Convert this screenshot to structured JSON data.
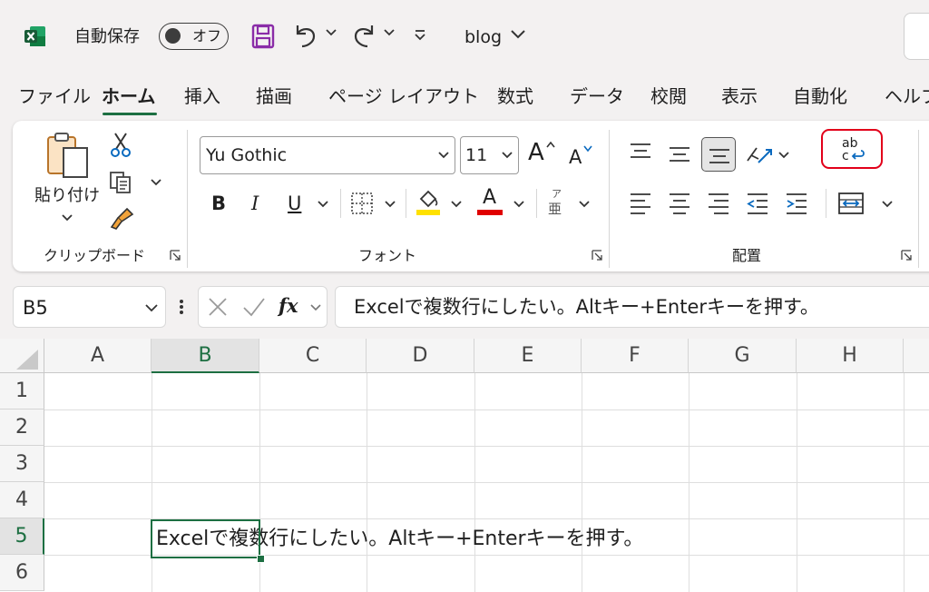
{
  "titlebar": {
    "autosave_label": "自動保存",
    "autosave_state": "オフ",
    "document_title": "blog"
  },
  "tabs": [
    "ファイル",
    "ホーム",
    "挿入",
    "描画",
    "ページ レイアウト",
    "数式",
    "データ",
    "校閲",
    "表示",
    "自動化",
    "ヘルプ"
  ],
  "active_tab": "ホーム",
  "ribbon": {
    "clipboard": {
      "paste_label": "貼り付け",
      "group_label": "クリップボード"
    },
    "font": {
      "font_name": "Yu Gothic",
      "font_size": "11",
      "bold": "B",
      "italic": "I",
      "underline": "U",
      "grow": "A",
      "shrink": "A",
      "font_color_glyph": "A",
      "phonetic_top": "ア",
      "phonetic_bottom": "亜",
      "group_label": "フォント"
    },
    "alignment": {
      "group_label": "配置",
      "wrap_text_glyph_top": "ab",
      "wrap_text_glyph_bottom": "c"
    }
  },
  "formula_bar": {
    "name_box": "B5",
    "fx": "fx",
    "content": "Excelで複数行にしたい。Altキー+Enterキーを押す。"
  },
  "sheet": {
    "columns": [
      "A",
      "B",
      "C",
      "D",
      "E",
      "F",
      "G",
      "H"
    ],
    "rows": [
      "1",
      "2",
      "3",
      "4",
      "5",
      "6"
    ],
    "active_cell": "B5",
    "cell_B5": "Excelで複数行にしたい。Altキー+Enterキーを押す。"
  },
  "colors": {
    "excel_green": "#1d6f42",
    "highlight_red": "#e2001a",
    "save_purple": "#8a2ca8",
    "fill_yellow": "#ffe100",
    "font_red": "#e00000"
  }
}
